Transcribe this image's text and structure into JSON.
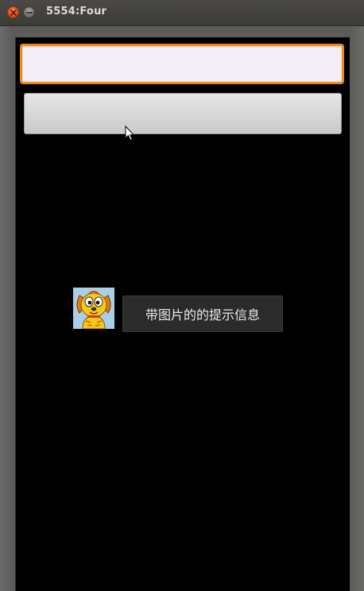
{
  "window": {
    "title": "5554:Four"
  },
  "app": {
    "edit_field": {
      "value": "",
      "placeholder": ""
    },
    "button": {
      "label": ""
    },
    "toast": {
      "message": "带图片的的提示信息",
      "image_icon": "cartoon-dog-icon"
    }
  },
  "colors": {
    "focus_border": "#f28a10",
    "screen_background": "#000000",
    "toast_background": "#2b2b2b",
    "close_button": "#df4a16"
  }
}
